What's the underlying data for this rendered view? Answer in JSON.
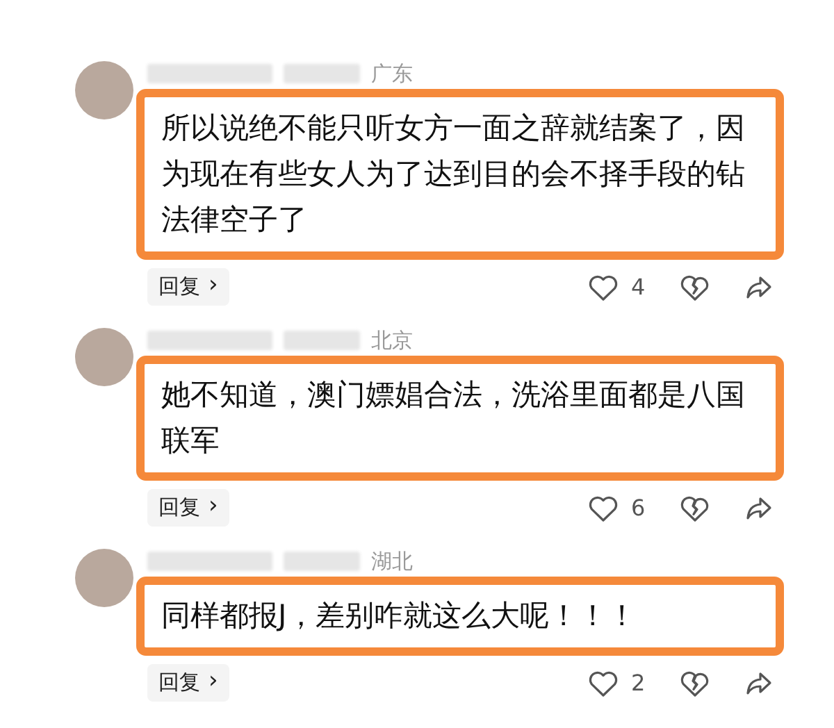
{
  "comments": [
    {
      "location": "广东",
      "text": "所以说绝不能只听女方一面之辞就结案了，因为现在有些女人为了达到目的会不择手段的钻法律空子了",
      "highlighted": true,
      "reply": "回复",
      "chevron": "›",
      "likes": "4"
    },
    {
      "location": "北京",
      "text": "她不知道，澳门嫖娼合法，洗浴里面都是八国联军",
      "highlighted": true,
      "reply": "回复",
      "chevron": "›",
      "likes": "6"
    },
    {
      "location": "湖北",
      "text": "同样都报J，差别咋就这么大呢！！！",
      "highlighted": true,
      "reply": "回复",
      "chevron": "›",
      "likes": "2"
    }
  ]
}
